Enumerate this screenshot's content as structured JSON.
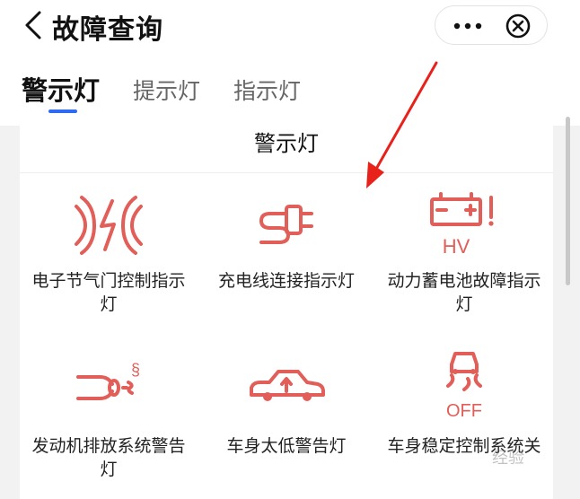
{
  "header": {
    "title": "故障查询"
  },
  "tabs": [
    {
      "label": "警示灯",
      "active": true
    },
    {
      "label": "提示灯",
      "active": false
    },
    {
      "label": "指示灯",
      "active": false
    }
  ],
  "section": {
    "title": "警示灯"
  },
  "items": [
    {
      "label": "电子节气门控制指示灯",
      "icon": "throttle-icon"
    },
    {
      "label": "充电线连接指示灯",
      "icon": "charging-plug-icon"
    },
    {
      "label": "动力蓄电池故障指示灯",
      "icon": "hv-battery-icon",
      "icon_text": "HV"
    },
    {
      "label": "发动机排放系统警告灯",
      "icon": "exhaust-icon",
      "icon_text": "§"
    },
    {
      "label": "车身太低警告灯",
      "icon": "low-vehicle-icon"
    },
    {
      "label": "车身稳定控制系统关",
      "icon": "stability-off-icon",
      "icon_text": "OFF"
    }
  ],
  "watermark": "经验",
  "colors": {
    "icon": "#e25e58",
    "accent": "#2f6bf2"
  },
  "annotation": {
    "type": "red-arrow",
    "color": "#e8221b"
  }
}
